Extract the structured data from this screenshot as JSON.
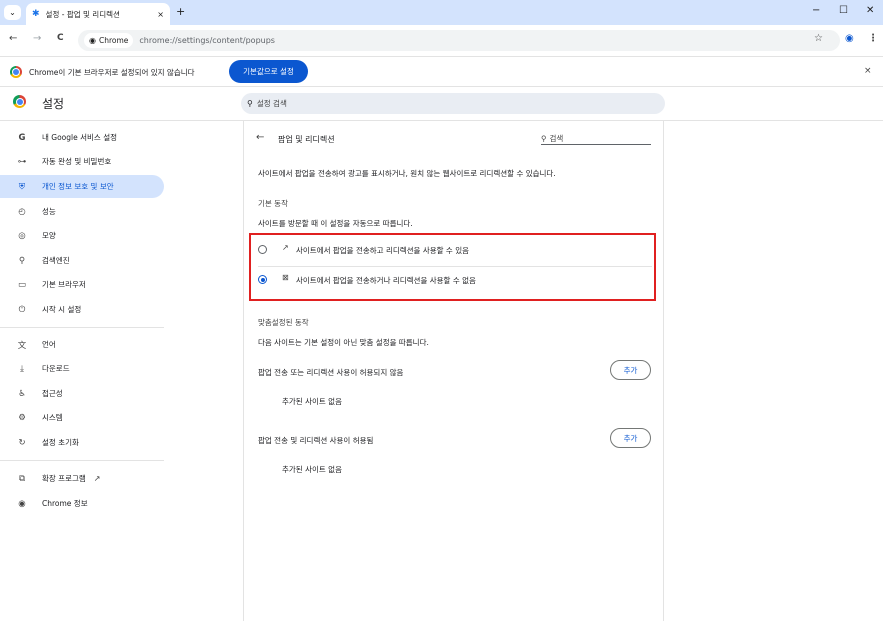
{
  "browser": {
    "tab": {
      "title": "설정 - 팝업 및 리디렉션",
      "icon": "gear-icon",
      "close": "×"
    },
    "new_tab": "+",
    "window_controls": {
      "minimize": "−",
      "maximize": "☐",
      "close": "✕"
    },
    "tab_search": "⌄",
    "nav": {
      "back": "←",
      "forward": "→",
      "reload": "C"
    },
    "site_chip": "Chrome",
    "url": "chrome://settings/content/popups",
    "bookmark": "☆",
    "profile": "◉",
    "menu": "⋮"
  },
  "infobar": {
    "text": "Chrome이 기본 브라우저로 설정되어 있지 않습니다",
    "button": "기본값으로 설정",
    "close": "×"
  },
  "settings": {
    "title": "설정",
    "search_placeholder": "설정 검색"
  },
  "sidebar": {
    "items": [
      {
        "label": "내 Google 서비스 설정",
        "icon": "google-icon",
        "glyph": "G"
      },
      {
        "label": "자동 완성 및 비밀번호",
        "icon": "key-icon",
        "glyph": "⊶"
      },
      {
        "label": "개인 정보 보호 및 보안",
        "icon": "shield-icon",
        "glyph": "⛨"
      },
      {
        "label": "성능",
        "icon": "speedometer-icon",
        "glyph": "◴"
      },
      {
        "label": "모양",
        "icon": "palette-icon",
        "glyph": "◎"
      },
      {
        "label": "검색엔진",
        "icon": "search-icon",
        "glyph": "⚲"
      },
      {
        "label": "기본 브라우저",
        "icon": "browser-icon",
        "glyph": "▭"
      },
      {
        "label": "시작 시 설정",
        "icon": "power-icon",
        "glyph": "⏻"
      },
      {
        "label": "언어",
        "icon": "translate-icon",
        "glyph": "文"
      },
      {
        "label": "다운로드",
        "icon": "download-icon",
        "glyph": "⤓"
      },
      {
        "label": "접근성",
        "icon": "accessibility-icon",
        "glyph": "♿"
      },
      {
        "label": "시스템",
        "icon": "wrench-icon",
        "glyph": "⚙"
      },
      {
        "label": "설정 초기화",
        "icon": "reset-icon",
        "glyph": "↻"
      },
      {
        "label": "확장 프로그램",
        "icon": "extension-icon",
        "glyph": "⧉",
        "external": "↗"
      },
      {
        "label": "Chrome 정보",
        "icon": "chrome-icon",
        "glyph": "◉"
      }
    ]
  },
  "page": {
    "back": "←",
    "title": "팝업 및 리디렉션",
    "search_label": "검색",
    "description": "사이트에서 팝업을 전송하여 광고를 표시하거나, 원치 않는 웹사이트로 리디렉션할 수 있습니다.",
    "default_behavior": {
      "heading": "기본 동작",
      "subtext": "사이트를 방문할 때 이 설정을 자동으로 따릅니다.",
      "options": [
        {
          "label": "사이트에서 팝업을 전송하고 리디렉션을 사용할 수 있음",
          "checked": false,
          "icon": "external-link-icon",
          "glyph": "↗"
        },
        {
          "label": "사이트에서 팝업을 전송하거나 리디렉션을 사용할 수 없음",
          "checked": true,
          "icon": "popup-blocked-icon",
          "glyph": "⊠"
        }
      ]
    },
    "custom_behavior": {
      "heading": "맞춤설정된 동작",
      "subtext": "다음 사이트는 기본 설정이 아닌 맞춤 설정을 따릅니다.",
      "sections": [
        {
          "label": "팝업 전송 또는 리디렉션 사용이 허용되지 않음",
          "button": "추가",
          "empty": "추가된 사이트 없음"
        },
        {
          "label": "팝업 전송 및 리디렉션 사용이 허용됨",
          "button": "추가",
          "empty": "추가된 사이트 없음"
        }
      ]
    }
  },
  "colors": {
    "accent": "#0b57d0",
    "highlight": "#e02020",
    "active_nav": "#d3e3fd"
  }
}
